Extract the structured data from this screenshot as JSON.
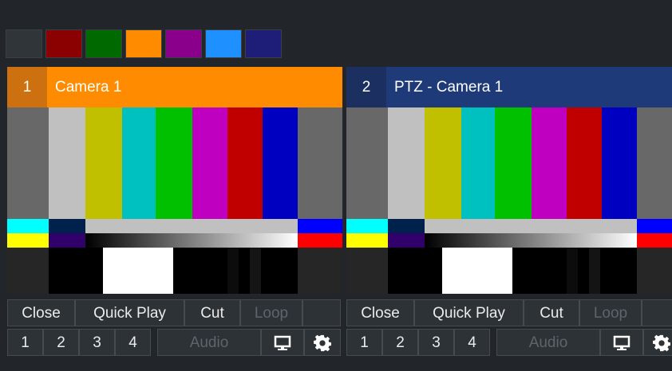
{
  "color_swatches": [
    {
      "name": "gray",
      "color": "#30353a"
    },
    {
      "name": "dark-red",
      "color": "#8b0000"
    },
    {
      "name": "green",
      "color": "#006a00"
    },
    {
      "name": "orange",
      "color": "#ff8c00"
    },
    {
      "name": "purple",
      "color": "#8b008b"
    },
    {
      "name": "light-blue",
      "color": "#1e90ff"
    },
    {
      "name": "navy",
      "color": "#1e1e78"
    }
  ],
  "inputs": [
    {
      "number": "1",
      "title": "Camera 1",
      "header_color": "#ff8c00",
      "number_bg": "#cc7010",
      "buttons": {
        "close": "Close",
        "quick_play": "Quick Play",
        "cut": "Cut",
        "loop": "Loop",
        "audio": "Audio"
      },
      "overlays": [
        "1",
        "2",
        "3",
        "4"
      ],
      "icons": {
        "display": "monitor-icon",
        "settings": "gear-icon"
      }
    },
    {
      "number": "2",
      "title": "PTZ - Camera 1",
      "header_color": "#1e3a78",
      "number_bg": "#1b2f60",
      "buttons": {
        "close": "Close",
        "quick_play": "Quick Play",
        "cut": "Cut",
        "loop": "Loop",
        "audio": "Audio"
      },
      "overlays": [
        "1",
        "2",
        "3",
        "4"
      ],
      "icons": {
        "display": "monitor-icon",
        "settings": "gear-icon"
      }
    }
  ]
}
